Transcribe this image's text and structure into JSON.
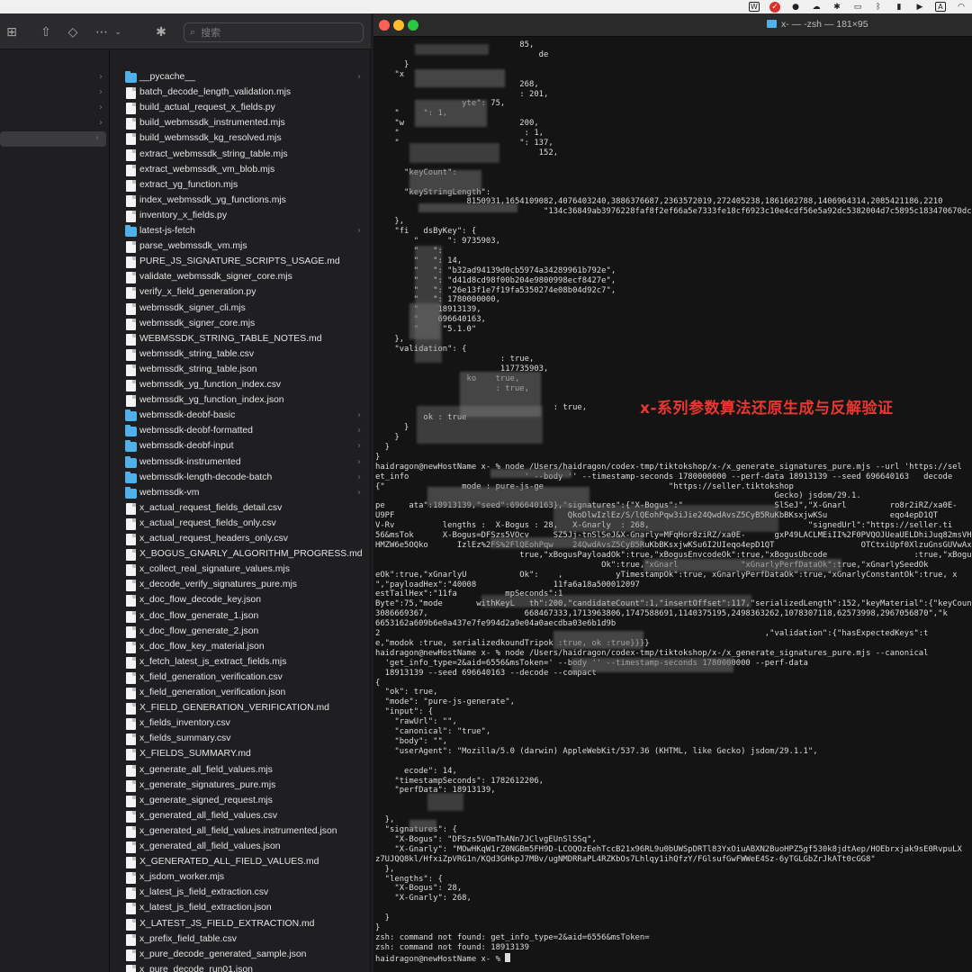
{
  "menubar": {
    "icons": [
      "app-w-icon",
      "red-circle-app-icon",
      "wechat-icon",
      "cloud-icon",
      "gear-icon",
      "display-icon",
      "bluetooth-icon",
      "battery-icon",
      "play-icon",
      "input-source-icon",
      "wifi-icon"
    ],
    "input_source_label": "A"
  },
  "finder": {
    "search_placeholder": "搜索",
    "files": [
      {
        "name": "__pycache__",
        "kind": "folder"
      },
      {
        "name": "batch_decode_length_validation.mjs",
        "kind": "doc"
      },
      {
        "name": "build_actual_request_x_fields.py",
        "kind": "doc"
      },
      {
        "name": "build_webmssdk_instrumented.mjs",
        "kind": "doc"
      },
      {
        "name": "build_webmssdk_kg_resolved.mjs",
        "kind": "doc"
      },
      {
        "name": "extract_webmssdk_string_table.mjs",
        "kind": "doc"
      },
      {
        "name": "extract_webmssdk_vm_blob.mjs",
        "kind": "doc"
      },
      {
        "name": "extract_yg_function.mjs",
        "kind": "doc"
      },
      {
        "name": "index_webmssdk_yg_functions.mjs",
        "kind": "doc"
      },
      {
        "name": "inventory_x_fields.py",
        "kind": "doc"
      },
      {
        "name": "latest-js-fetch",
        "kind": "folder"
      },
      {
        "name": "parse_webmssdk_vm.mjs",
        "kind": "doc"
      },
      {
        "name": "PURE_JS_SIGNATURE_SCRIPTS_USAGE.md",
        "kind": "doc"
      },
      {
        "name": "validate_webmssdk_signer_core.mjs",
        "kind": "doc"
      },
      {
        "name": "verify_x_field_generation.py",
        "kind": "doc"
      },
      {
        "name": "webmssdk_signer_cli.mjs",
        "kind": "doc"
      },
      {
        "name": "webmssdk_signer_core.mjs",
        "kind": "doc"
      },
      {
        "name": "WEBMSSDK_STRING_TABLE_NOTES.md",
        "kind": "doc"
      },
      {
        "name": "webmssdk_string_table.csv",
        "kind": "doc"
      },
      {
        "name": "webmssdk_string_table.json",
        "kind": "doc"
      },
      {
        "name": "webmssdk_yg_function_index.csv",
        "kind": "doc"
      },
      {
        "name": "webmssdk_yg_function_index.json",
        "kind": "doc"
      },
      {
        "name": "webmssdk-deobf-basic",
        "kind": "folder"
      },
      {
        "name": "webmssdk-deobf-formatted",
        "kind": "folder"
      },
      {
        "name": "webmssdk-deobf-input",
        "kind": "folder"
      },
      {
        "name": "webmssdk-instrumented",
        "kind": "folder"
      },
      {
        "name": "webmssdk-length-decode-batch",
        "kind": "folder"
      },
      {
        "name": "webmssdk-vm",
        "kind": "folder"
      },
      {
        "name": "x_actual_request_fields_detail.csv",
        "kind": "doc"
      },
      {
        "name": "x_actual_request_fields_only.csv",
        "kind": "doc"
      },
      {
        "name": "x_actual_request_headers_only.csv",
        "kind": "doc"
      },
      {
        "name": "X_BOGUS_GNARLY_ALGORITHM_PROGRESS.md",
        "kind": "doc"
      },
      {
        "name": "x_collect_real_signature_values.mjs",
        "kind": "doc"
      },
      {
        "name": "x_decode_verify_signatures_pure.mjs",
        "kind": "doc"
      },
      {
        "name": "x_doc_flow_decode_key.json",
        "kind": "doc"
      },
      {
        "name": "x_doc_flow_generate_1.json",
        "kind": "doc"
      },
      {
        "name": "x_doc_flow_generate_2.json",
        "kind": "doc"
      },
      {
        "name": "x_doc_flow_key_material.json",
        "kind": "doc"
      },
      {
        "name": "x_fetch_latest_js_extract_fields.mjs",
        "kind": "doc"
      },
      {
        "name": "x_field_generation_verification.csv",
        "kind": "doc"
      },
      {
        "name": "x_field_generation_verification.json",
        "kind": "doc"
      },
      {
        "name": "X_FIELD_GENERATION_VERIFICATION.md",
        "kind": "doc"
      },
      {
        "name": "x_fields_inventory.csv",
        "kind": "doc"
      },
      {
        "name": "x_fields_summary.csv",
        "kind": "doc"
      },
      {
        "name": "X_FIELDS_SUMMARY.md",
        "kind": "doc"
      },
      {
        "name": "x_generate_all_field_values.mjs",
        "kind": "doc"
      },
      {
        "name": "x_generate_signatures_pure.mjs",
        "kind": "doc"
      },
      {
        "name": "x_generate_signed_request.mjs",
        "kind": "doc"
      },
      {
        "name": "x_generated_all_field_values.csv",
        "kind": "doc"
      },
      {
        "name": "x_generated_all_field_values.instrumented.json",
        "kind": "doc"
      },
      {
        "name": "x_generated_all_field_values.json",
        "kind": "doc"
      },
      {
        "name": "X_GENERATED_ALL_FIELD_VALUES.md",
        "kind": "doc"
      },
      {
        "name": "x_jsdom_worker.mjs",
        "kind": "doc"
      },
      {
        "name": "x_latest_js_field_extraction.csv",
        "kind": "doc"
      },
      {
        "name": "x_latest_js_field_extraction.json",
        "kind": "doc"
      },
      {
        "name": "X_LATEST_JS_FIELD_EXTRACTION.md",
        "kind": "doc"
      },
      {
        "name": "x_prefix_field_table.csv",
        "kind": "doc"
      },
      {
        "name": "x_pure_decode_generated_sample.json",
        "kind": "doc"
      },
      {
        "name": "x_pure_decode_run01.json",
        "kind": "doc"
      }
    ]
  },
  "terminal": {
    "title": "x- — -zsh — 181×95",
    "overlay_caption": "x-系列参数算法还原生成与反解验证",
    "lines": [
      "                              85,",
      "                                  de",
      "      }",
      "    \"x",
      "                              268,",
      "                              : 201,",
      "                  yte\": 75,",
      "    \"     \": 1,",
      "    \"w                        200,",
      "    \"                          : 1,",
      "    \"                         \": 137,",
      "                                  152,",
      "",
      "      \"keyCount\":",
      "",
      "      \"keyStringLength\":",
      "                   8150931,1654109082,4076403240,3886376687,2363572019,272405238,1861602788,1406964314,2085421186,2210",
      "                                   \"134c36849ab3976228faf8f2ef66a5e7333fe18cf6923c10e4cdf56e5a92dc5382004d7c5895c183470670dc32bcb046\"",
      "    },",
      "    \"fi   dsByKey\": {",
      "        \"      \": 9735903,",
      "        \"   \":",
      "        \"   \": 14,",
      "        \"   \": \"b32ad94139d0cb5974a34289961b792e\",",
      "        \"   \": \"d41d8cd98f00b204e9800998ecf8427e\",",
      "        \"   \": \"26e13f1e7f19fa5350274e08b04d92c7\",",
      "        \"   \": 1780000000,",
      "        \"    18913139,",
      "        \"    696640163,",
      "        \"     \"5.1.0\"",
      "    },",
      "    \"validation\": {",
      "                          : true,",
      "                          117735903,",
      "                   ko    true,",
      "                         : true,",
      "",
      "                                     : true,",
      "          ok : true",
      "      }",
      "    }",
      "  }",
      "}",
      "haidragon@newHostName x- % node /Users/haidragon/codex-tmp/tiktokshop/x-/x_generate_signatures_pure.mjs --url 'https://sel",
      "et_info                        ' --body '' --timestamp-seconds 1780000000 --perf-data 18913139 --seed 696640163   decode",
      "{\"                mode : pure-js-ge                          \"https://seller.tiktokshop",
      "                                                                                   Gecko) jsdom/29.1.",
      "pe     ata\":18913139,\"seed\":696640163},\"signatures\":{\"X-Bogus\":\"                   SlSeJ\",\"X-Gnarl         ro8r2iRZ/xa0E-",
      "U9PF                                    QkoDlwIzlEz/S/lQEohPqw3iJie24QwdAvsZ5CyB5RuKbBKsxjwKSu             eqo4epD1QT",
      "V-Rv          lengths :  X-Bogus : 28,   X-Gnarly  : 268,                                 \"signedUrl\":\"https://seller.ti",
      "56&msTok      X-Bogus=DFSzs5VOcv     SZ5Jj-tnSlSeJ&X-Gnarly=MFqHor8ziRZ/xa0E-      gxP49LACLMEiII%2F0PVQOJUeaUELDhiJuq82msVHKO",
      "HMZW6e5OQko      IzlEz%2FS%2FlQEohPqw    24QwdAvsZ5CyB5RuKbBKsxjwKSu6I2UIeqo4epD1QT                  OTCtxiUpf0XlzuGnsGUVwAxgu",
      "                              true,\"xBogusPayloadOk\":true,\"xBogusEnvcodeOk\":true,\"xBogusUbcode                  :true,\"xBogusP",
      "                                               Ok\":true,\"xGnarl             \"xGnarlyPerfDataOk\":true,\"xGnarlySeedOk",
      "eOk\":true,\"xGnarlyU           Ok\":    ,           yTimestampOk\":true, xGnarlyPerfDataOk\":true,\"xGnarlyConstantOk\":true, x",
      "\",\"payloadHex\":\"40008                11fa6a18a500012097",
      "estTailHex\":\"11fa          mpSeconds\":1",
      "Byte\":75,\"mode       withKeyL   th\":200,\"candidateCount\":1,\"insertOffset\":117,\"serializedLength\":152,\"keyMaterial\":{\"keyCoun",
      "3086669367,                    668467333,1713963806,1747588691,1140375195,2498363262,1078307118,62573998,2967056870\",\"k",
      "6653162a609b6e0a437e7fe994d2a9e04a0aecdba03e6b1d9b",
      "2                                                                                ,\"validation\":{\"hasExpectedKeys\":t",
      "e,\"modok :true, serializedkoundTripok :true, ok :true}}}}",
      "haidragon@newHostName x- % node /Users/haidragon/codex-tmp/tiktokshop/x-/x_generate_signatures_pure.mjs --canonical",
      "  'get_info_type=2&aid=6556&msToken=' --body '' --timestamp-seconds 1780000000 --perf-data",
      "  18913139 --seed 696640163 --decode --compact",
      "{",
      "  \"ok\": true,",
      "  \"mode\": \"pure-js-generate\",",
      "  \"input\": {",
      "    \"rawUrl\": \"\",",
      "    \"canonical\": \"true\",",
      "    \"body\": \"\",",
      "    \"userAgent\": \"Mozilla/5.0 (darwin) AppleWebKit/537.36 (KHTML, like Gecko) jsdom/29.1.1\",",
      "",
      "      ecode\": 14,",
      "    \"timestampSeconds\": 1782612206,",
      "    \"perfData\": 18913139,",
      "",
      "",
      "  },",
      "  \"signatures\": {",
      "    \"X-Bogus\": \"DFSzs5VOmThANn7JClvgEUnSlSSq\",",
      "    \"X-Gnarly\": \"MOwHKqW1rZ0NGBm5FH9D-LCOQOzEehTccB21x96RL9u0bUWSpDRTl83YxOiuABXN2BuoHPZ5gf530k8jdtAep/HOEbrxjak9sE0RvpuLX",
      "z7UJQQ8kl/HfxiZpVRG1n/KQd3GHkpJ7MBv/ugNMDRRaPL4RZKbOs7Lhlqy1ihQfzY/FGlsufGwFWWeE4Sz-6yTGLGbZrJkATt0cGG8\"",
      "  },",
      "  \"lengths\": {",
      "    \"X-Bogus\": 28,",
      "    \"X-Gnarly\": 268,",
      "",
      "  }",
      "}",
      "zsh: command not found: get_info_type=2&aid=6556&msToken=",
      "zsh: command not found: 18913139",
      "haidragon@newHostName x- % "
    ]
  }
}
